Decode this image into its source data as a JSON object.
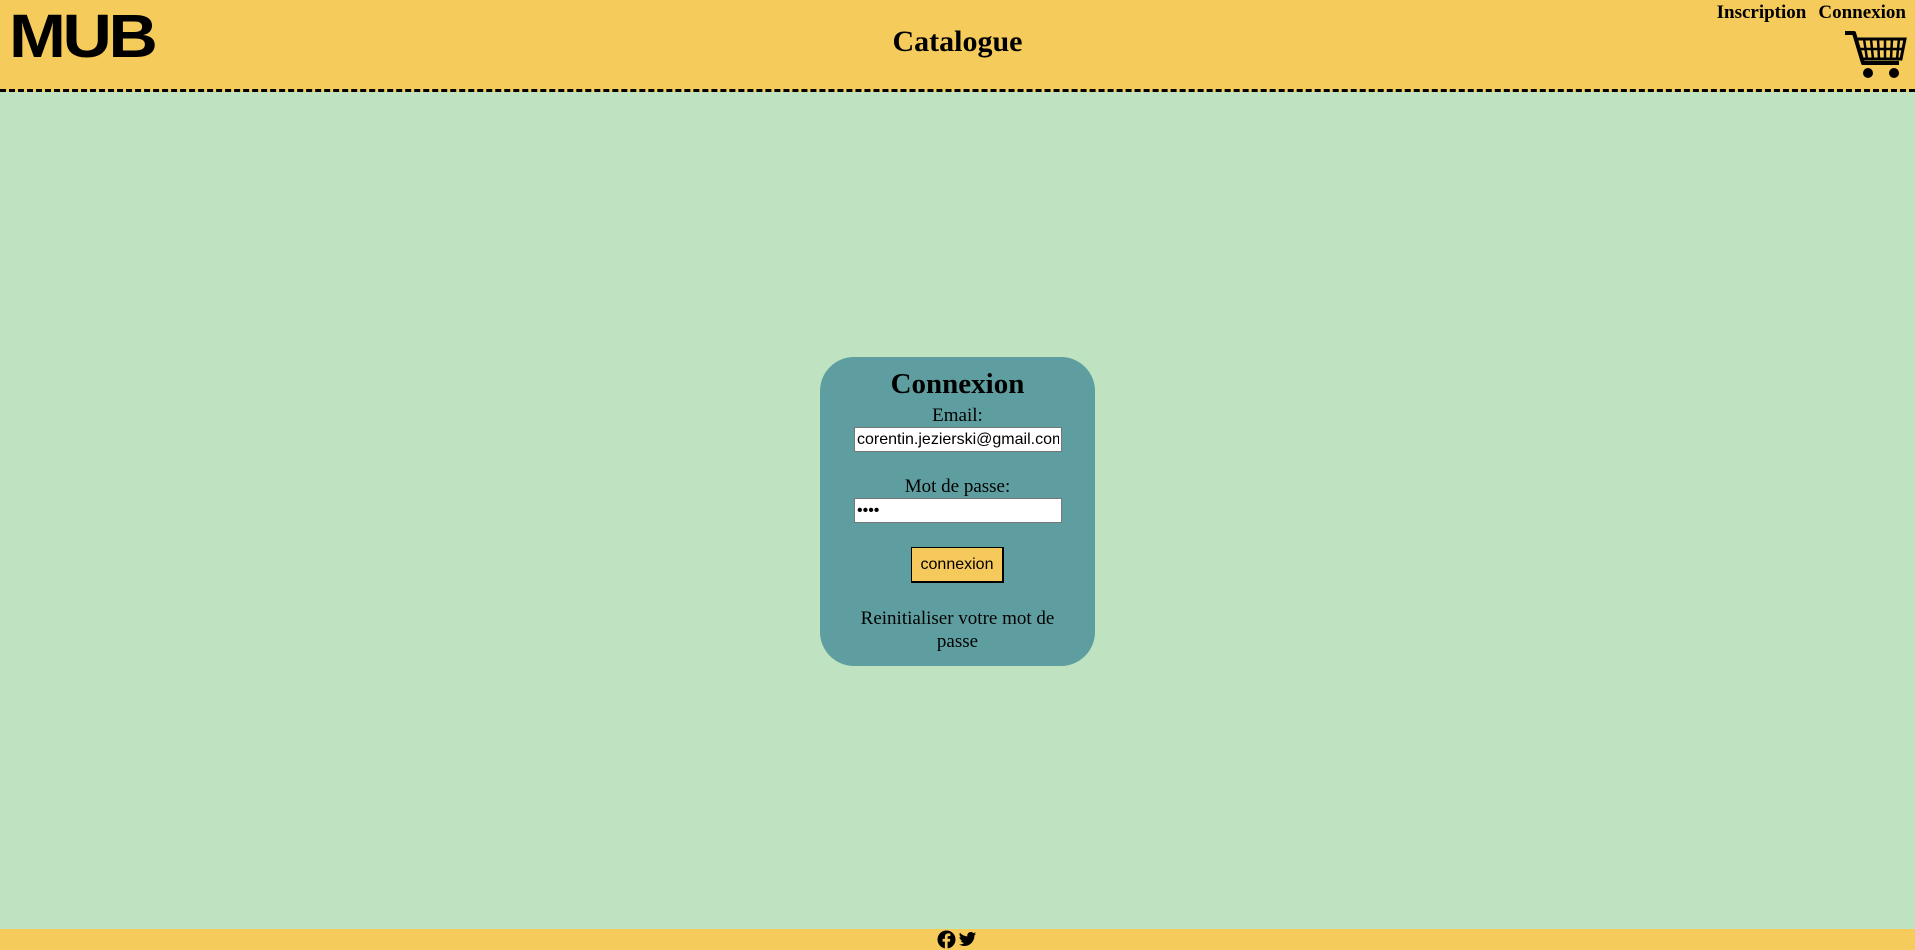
{
  "header": {
    "logo_text": "MUB",
    "title": "Catalogue",
    "links": [
      "Inscription",
      "Connexion"
    ],
    "cart_icon": "shopping-cart-icon"
  },
  "login": {
    "heading": "Connexion",
    "email_label": "Email:",
    "email_value": "corentin.jezierski@gmail.com",
    "password_label": "Mot de passe:",
    "password_value": "••••",
    "submit_label": "connexion",
    "reset_link": "Reinitialiser votre mot de passe"
  },
  "footer": {
    "icons": [
      "facebook-icon",
      "twitter-icon"
    ]
  },
  "colors": {
    "header_bg": "#f5cb5c",
    "page_bg": "#bfe3c1",
    "card_bg": "#5f9ea0",
    "button_bg": "#f5c95b"
  }
}
